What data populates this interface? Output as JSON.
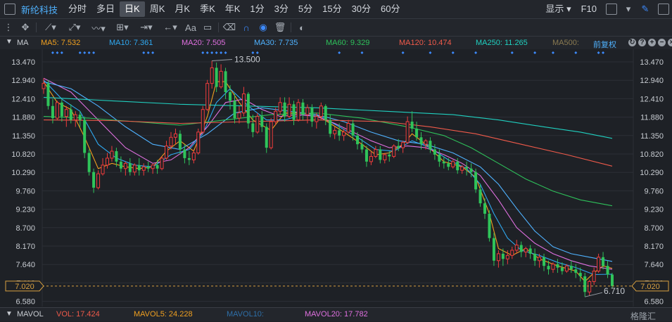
{
  "period_bar": {
    "stock_name": "新纶科技",
    "tabs": [
      "分时",
      "多日",
      "日K",
      "周K",
      "月K",
      "季K",
      "年K",
      "1分",
      "3分",
      "5分",
      "15分",
      "30分",
      "60分"
    ],
    "active_tab": "日K",
    "display_label": "显示",
    "f10_label": "F10"
  },
  "toolbar": {
    "aa_label": "Aa"
  },
  "indicators": {
    "ma_label": "MA",
    "ma5": "MA5: 7.532",
    "ma10": "MA10: 7.361",
    "ma20": "MA20: 7.505",
    "ma30": "MA30: 7.735",
    "ma60": "MA60: 9.329",
    "ma120": "MA120: 10.474",
    "ma250": "MA250: 11.265",
    "ma500": "MA500:",
    "adjust_label": "前复权",
    "colors": {
      "ma5": "#f0a020",
      "ma10": "#2fa8f0",
      "ma20": "#e070e0",
      "ma30": "#4fb2ff",
      "ma60": "#2ec05a",
      "ma120": "#f05a4a",
      "ma250": "#20d0c0",
      "ma500": "#8a7a50"
    }
  },
  "volume_bar": {
    "label": "MAVOL",
    "vol": "VOL: 17.424",
    "mavol5": "MAVOL5: 24.228",
    "mavol10": "MAVOL10:",
    "mavol20": "MAVOL20: 17.782"
  },
  "watermark": "格隆汇",
  "chart_data": {
    "type": "candlestick",
    "y_ticks": [
      "13.470",
      "12.940",
      "12.410",
      "11.880",
      "11.350",
      "10.820",
      "10.290",
      "9.760",
      "9.230",
      "8.700",
      "8.170",
      "7.640",
      "7.110",
      "6.580"
    ],
    "ylim": [
      6.45,
      13.65
    ],
    "current_price": "7.020",
    "high_annotation": "13.500",
    "low_annotation": "6.710",
    "up_color": "#f03c3c",
    "down_color": "#2fc45a",
    "candles": [
      [
        12.7,
        13.0,
        12.85,
        12.55
      ],
      [
        12.85,
        12.95,
        12.2,
        12.1
      ],
      [
        12.2,
        12.4,
        11.85,
        11.7
      ],
      [
        11.85,
        12.35,
        12.3,
        11.8
      ],
      [
        12.3,
        12.4,
        11.9,
        11.75
      ],
      [
        11.9,
        12.2,
        12.1,
        11.6
      ],
      [
        12.1,
        12.25,
        11.8,
        11.7
      ],
      [
        11.8,
        12.05,
        11.95,
        11.6
      ],
      [
        11.95,
        12.05,
        11.8,
        11.6
      ],
      [
        11.8,
        11.9,
        10.85,
        10.7
      ],
      [
        10.85,
        10.95,
        10.3,
        10.2
      ],
      [
        10.3,
        10.4,
        9.85,
        9.7
      ],
      [
        9.85,
        10.35,
        10.25,
        9.8
      ],
      [
        10.25,
        10.7,
        10.5,
        10.2
      ],
      [
        10.5,
        10.85,
        10.7,
        10.4
      ],
      [
        10.7,
        11.05,
        10.9,
        10.6
      ],
      [
        10.9,
        11.0,
        10.6,
        10.45
      ],
      [
        10.6,
        10.75,
        10.4,
        10.3
      ],
      [
        10.4,
        10.6,
        10.55,
        10.2
      ],
      [
        10.55,
        10.7,
        10.3,
        10.2
      ],
      [
        10.3,
        10.55,
        10.5,
        10.2
      ],
      [
        10.5,
        10.7,
        10.35,
        10.2
      ],
      [
        10.35,
        10.55,
        10.45,
        10.2
      ],
      [
        10.45,
        10.6,
        10.4,
        10.3
      ],
      [
        10.4,
        10.55,
        10.5,
        10.25
      ],
      [
        10.5,
        10.65,
        10.4,
        10.25
      ],
      [
        10.4,
        10.75,
        10.7,
        10.35
      ],
      [
        10.7,
        11.2,
        11.05,
        10.65
      ],
      [
        11.05,
        11.45,
        11.3,
        10.95
      ],
      [
        11.3,
        11.55,
        11.4,
        11.1
      ],
      [
        11.4,
        11.5,
        10.95,
        10.8
      ],
      [
        10.95,
        11.1,
        10.7,
        10.55
      ],
      [
        10.7,
        10.9,
        10.65,
        10.5
      ],
      [
        10.65,
        10.95,
        10.85,
        10.55
      ],
      [
        10.85,
        11.55,
        11.45,
        10.8
      ],
      [
        11.45,
        12.2,
        12.1,
        11.4
      ],
      [
        12.1,
        12.95,
        12.85,
        12.05
      ],
      [
        12.85,
        13.5,
        13.3,
        12.7
      ],
      [
        13.3,
        13.45,
        12.75,
        12.6
      ],
      [
        12.75,
        13.4,
        13.2,
        12.7
      ],
      [
        13.2,
        13.3,
        12.6,
        12.4
      ],
      [
        12.6,
        12.8,
        12.35,
        12.1
      ],
      [
        12.35,
        12.55,
        11.85,
        11.7
      ],
      [
        11.85,
        12.2,
        12.0,
        11.7
      ],
      [
        12.0,
        12.75,
        12.55,
        11.9
      ],
      [
        12.55,
        12.6,
        11.7,
        11.55
      ],
      [
        11.7,
        11.95,
        11.45,
        11.3
      ],
      [
        11.45,
        12.0,
        11.9,
        11.4
      ],
      [
        11.9,
        12.05,
        11.6,
        11.45
      ],
      [
        11.6,
        11.7,
        11.0,
        10.85
      ],
      [
        11.0,
        11.85,
        11.75,
        10.95
      ],
      [
        11.75,
        12.15,
        12.05,
        11.65
      ],
      [
        12.05,
        12.45,
        12.3,
        11.95
      ],
      [
        12.3,
        12.45,
        11.9,
        11.75
      ],
      [
        11.9,
        12.45,
        12.25,
        11.85
      ],
      [
        12.25,
        12.35,
        11.8,
        11.65
      ],
      [
        11.8,
        12.4,
        12.3,
        11.75
      ],
      [
        12.3,
        12.4,
        11.95,
        11.8
      ],
      [
        11.95,
        12.25,
        12.15,
        11.7
      ],
      [
        12.15,
        12.25,
        11.75,
        11.6
      ],
      [
        11.75,
        12.0,
        11.9,
        11.55
      ],
      [
        11.9,
        12.3,
        12.2,
        11.8
      ],
      [
        12.2,
        12.25,
        11.8,
        11.65
      ],
      [
        11.8,
        11.95,
        11.4,
        11.3
      ],
      [
        11.4,
        11.6,
        11.5,
        11.25
      ],
      [
        11.5,
        11.7,
        11.35,
        11.2
      ],
      [
        11.35,
        11.55,
        11.45,
        11.2
      ],
      [
        11.45,
        11.8,
        11.7,
        11.4
      ],
      [
        11.7,
        11.8,
        11.35,
        11.2
      ],
      [
        11.35,
        11.45,
        11.1,
        10.95
      ],
      [
        11.1,
        11.25,
        10.95,
        10.85
      ],
      [
        10.95,
        11.05,
        10.6,
        10.45
      ],
      [
        10.6,
        10.9,
        10.75,
        10.5
      ],
      [
        10.75,
        11.05,
        10.95,
        10.7
      ],
      [
        10.95,
        11.05,
        10.65,
        10.55
      ],
      [
        10.65,
        10.85,
        10.8,
        10.55
      ],
      [
        10.8,
        10.9,
        10.75,
        10.6
      ],
      [
        10.75,
        11.1,
        11.05,
        10.7
      ],
      [
        11.05,
        11.25,
        11.0,
        10.9
      ],
      [
        11.0,
        11.2,
        11.15,
        10.85
      ],
      [
        11.15,
        11.9,
        11.75,
        11.1
      ],
      [
        11.75,
        12.05,
        11.55,
        11.45
      ],
      [
        11.55,
        11.75,
        11.3,
        11.2
      ],
      [
        11.3,
        11.45,
        11.1,
        10.95
      ],
      [
        11.1,
        11.25,
        11.2,
        10.95
      ],
      [
        11.2,
        11.3,
        10.95,
        10.85
      ],
      [
        10.95,
        11.1,
        10.8,
        10.65
      ],
      [
        10.8,
        10.95,
        10.6,
        10.45
      ],
      [
        10.6,
        10.75,
        10.55,
        10.4
      ],
      [
        10.55,
        10.7,
        10.45,
        10.35
      ],
      [
        10.45,
        10.65,
        10.6,
        10.4
      ],
      [
        10.6,
        10.7,
        10.35,
        10.25
      ],
      [
        10.35,
        10.5,
        10.45,
        10.25
      ],
      [
        10.45,
        10.6,
        10.4,
        10.2
      ],
      [
        10.4,
        10.55,
        10.3,
        10.15
      ],
      [
        10.3,
        10.4,
        9.8,
        9.7
      ],
      [
        9.8,
        9.95,
        9.4,
        9.3
      ],
      [
        9.4,
        9.55,
        9.1,
        8.95
      ],
      [
        9.1,
        9.2,
        8.4,
        8.3
      ],
      [
        8.4,
        8.55,
        7.75,
        7.6
      ],
      [
        7.75,
        8.05,
        7.95,
        7.55
      ],
      [
        7.95,
        8.1,
        7.8,
        7.6
      ],
      [
        7.8,
        8.05,
        7.9,
        7.65
      ],
      [
        7.9,
        8.15,
        8.05,
        7.8
      ],
      [
        8.05,
        8.35,
        8.2,
        7.95
      ],
      [
        8.2,
        8.3,
        8.0,
        7.85
      ],
      [
        8.0,
        8.15,
        8.1,
        7.85
      ],
      [
        8.1,
        8.2,
        7.95,
        7.8
      ],
      [
        7.95,
        8.1,
        7.75,
        7.6
      ],
      [
        7.75,
        7.95,
        7.85,
        7.55
      ],
      [
        7.85,
        7.95,
        7.6,
        7.45
      ],
      [
        7.6,
        7.75,
        7.5,
        7.35
      ],
      [
        7.5,
        7.7,
        7.65,
        7.4
      ],
      [
        7.65,
        7.8,
        7.55,
        7.4
      ],
      [
        7.55,
        7.7,
        7.45,
        7.35
      ],
      [
        7.45,
        7.65,
        7.6,
        7.4
      ],
      [
        7.6,
        7.75,
        7.5,
        7.4
      ],
      [
        7.5,
        7.65,
        7.4,
        7.25
      ],
      [
        7.4,
        7.55,
        7.3,
        7.15
      ],
      [
        7.3,
        7.4,
        6.85,
        6.71
      ],
      [
        6.85,
        7.2,
        7.15,
        6.75
      ],
      [
        7.15,
        7.55,
        7.45,
        7.05
      ],
      [
        7.45,
        7.95,
        7.85,
        7.4
      ],
      [
        7.85,
        8.0,
        7.6,
        7.5
      ],
      [
        7.6,
        7.75,
        7.35,
        7.25
      ],
      [
        7.35,
        7.4,
        7.02,
        6.95
      ]
    ],
    "moving_averages": {
      "ma5": [
        [
          0,
          12.9
        ],
        [
          3,
          12.3
        ],
        [
          6,
          12.1
        ],
        [
          9,
          11.3
        ],
        [
          12,
          10.4
        ],
        [
          15,
          10.55
        ],
        [
          18,
          10.45
        ],
        [
          21,
          10.4
        ],
        [
          24,
          10.45
        ],
        [
          27,
          10.9
        ],
        [
          30,
          11.2
        ],
        [
          33,
          10.9
        ],
        [
          36,
          11.9
        ],
        [
          38,
          12.9
        ],
        [
          40,
          12.9
        ],
        [
          43,
          12.3
        ],
        [
          46,
          11.8
        ],
        [
          50,
          11.5
        ],
        [
          53,
          12.0
        ],
        [
          56,
          12.0
        ],
        [
          60,
          11.95
        ],
        [
          63,
          11.7
        ],
        [
          66,
          11.45
        ],
        [
          70,
          11.1
        ],
        [
          73,
          10.8
        ],
        [
          76,
          10.85
        ],
        [
          79,
          11.1
        ],
        [
          81,
          11.4
        ],
        [
          84,
          11.1
        ],
        [
          88,
          10.6
        ],
        [
          92,
          10.45
        ],
        [
          95,
          10.15
        ],
        [
          98,
          9.1
        ],
        [
          100,
          8.1
        ],
        [
          103,
          7.9
        ],
        [
          106,
          8.1
        ],
        [
          109,
          7.8
        ],
        [
          113,
          7.6
        ],
        [
          117,
          7.45
        ],
        [
          119,
          7.15
        ],
        [
          121,
          7.4
        ],
        [
          123,
          7.6
        ],
        [
          125,
          7.53
        ]
      ],
      "ma10": [
        [
          0,
          12.95
        ],
        [
          4,
          12.4
        ],
        [
          8,
          12.05
        ],
        [
          12,
          11.1
        ],
        [
          16,
          10.7
        ],
        [
          20,
          10.5
        ],
        [
          24,
          10.45
        ],
        [
          28,
          10.8
        ],
        [
          32,
          10.95
        ],
        [
          35,
          11.4
        ],
        [
          38,
          12.3
        ],
        [
          41,
          12.7
        ],
        [
          45,
          12.2
        ],
        [
          49,
          11.8
        ],
        [
          53,
          11.8
        ],
        [
          57,
          11.95
        ],
        [
          61,
          11.9
        ],
        [
          65,
          11.6
        ],
        [
          69,
          11.3
        ],
        [
          73,
          10.95
        ],
        [
          77,
          10.9
        ],
        [
          81,
          11.2
        ],
        [
          85,
          11.0
        ],
        [
          89,
          10.65
        ],
        [
          93,
          10.4
        ],
        [
          96,
          9.95
        ],
        [
          99,
          9.1
        ],
        [
          102,
          8.4
        ],
        [
          105,
          8.05
        ],
        [
          109,
          7.9
        ],
        [
          113,
          7.7
        ],
        [
          117,
          7.55
        ],
        [
          121,
          7.35
        ],
        [
          125,
          7.36
        ]
      ],
      "ma20": [
        [
          0,
          13.0
        ],
        [
          6,
          12.6
        ],
        [
          12,
          11.8
        ],
        [
          18,
          11.0
        ],
        [
          24,
          10.55
        ],
        [
          28,
          10.65
        ],
        [
          32,
          11.0
        ],
        [
          36,
          11.6
        ],
        [
          40,
          12.3
        ],
        [
          44,
          12.4
        ],
        [
          48,
          12.1
        ],
        [
          52,
          11.9
        ],
        [
          56,
          11.95
        ],
        [
          60,
          11.9
        ],
        [
          64,
          11.7
        ],
        [
          68,
          11.45
        ],
        [
          72,
          11.2
        ],
        [
          76,
          11.0
        ],
        [
          80,
          11.05
        ],
        [
          84,
          11.0
        ],
        [
          88,
          10.8
        ],
        [
          92,
          10.55
        ],
        [
          96,
          10.2
        ],
        [
          100,
          9.5
        ],
        [
          104,
          8.7
        ],
        [
          108,
          8.25
        ],
        [
          112,
          7.95
        ],
        [
          116,
          7.75
        ],
        [
          120,
          7.6
        ],
        [
          125,
          7.5
        ]
      ],
      "ma30": [
        [
          0,
          12.9
        ],
        [
          6,
          12.7
        ],
        [
          12,
          12.2
        ],
        [
          18,
          11.6
        ],
        [
          24,
          11.1
        ],
        [
          30,
          10.95
        ],
        [
          36,
          11.4
        ],
        [
          42,
          12.0
        ],
        [
          48,
          12.15
        ],
        [
          54,
          12.05
        ],
        [
          60,
          11.95
        ],
        [
          66,
          11.75
        ],
        [
          72,
          11.45
        ],
        [
          78,
          11.2
        ],
        [
          84,
          11.1
        ],
        [
          90,
          10.85
        ],
        [
          96,
          10.45
        ],
        [
          100,
          9.95
        ],
        [
          104,
          9.25
        ],
        [
          108,
          8.6
        ],
        [
          112,
          8.15
        ],
        [
          116,
          7.95
        ],
        [
          120,
          7.85
        ],
        [
          125,
          7.73
        ]
      ],
      "ma60": [
        [
          0,
          11.9
        ],
        [
          10,
          11.85
        ],
        [
          20,
          11.75
        ],
        [
          30,
          11.65
        ],
        [
          40,
          11.8
        ],
        [
          50,
          11.95
        ],
        [
          60,
          12.0
        ],
        [
          70,
          11.85
        ],
        [
          80,
          11.6
        ],
        [
          88,
          11.35
        ],
        [
          94,
          11.0
        ],
        [
          100,
          10.55
        ],
        [
          106,
          10.1
        ],
        [
          112,
          9.75
        ],
        [
          118,
          9.5
        ],
        [
          125,
          9.33
        ]
      ],
      "ma120": [
        [
          0,
          11.8
        ],
        [
          15,
          11.78
        ],
        [
          30,
          11.7
        ],
        [
          45,
          11.75
        ],
        [
          60,
          11.8
        ],
        [
          75,
          11.75
        ],
        [
          85,
          11.6
        ],
        [
          95,
          11.4
        ],
        [
          105,
          11.1
        ],
        [
          115,
          10.8
        ],
        [
          125,
          10.47
        ]
      ],
      "ma250": [
        [
          0,
          12.45
        ],
        [
          15,
          12.35
        ],
        [
          30,
          12.25
        ],
        [
          45,
          12.2
        ],
        [
          60,
          12.15
        ],
        [
          75,
          12.05
        ],
        [
          90,
          11.95
        ],
        [
          100,
          11.8
        ],
        [
          110,
          11.6
        ],
        [
          118,
          11.45
        ],
        [
          125,
          11.27
        ]
      ]
    }
  }
}
